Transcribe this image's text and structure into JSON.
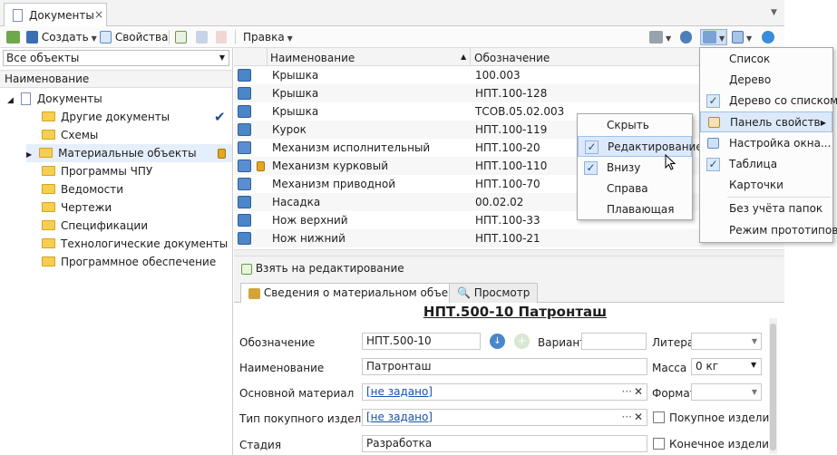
{
  "tab": {
    "title": "Документы",
    "close": "×"
  },
  "toolbar": {
    "create": "Создать",
    "properties": "Свойства",
    "edit_menu": "Правка"
  },
  "left": {
    "filter": "Все объекты",
    "header": "Наименование",
    "root": "Документы",
    "items": [
      "Другие документы",
      "Схемы",
      "Материальные объекты",
      "Программы ЧПУ",
      "Ведомости",
      "Чертежи",
      "Спецификации",
      "Технологические документы",
      "Программное обеспечение"
    ]
  },
  "grid": {
    "col_name": "Наименование",
    "col_designation": "Обозначение",
    "rows": [
      {
        "name": "Крышка",
        "designation": "100.003"
      },
      {
        "name": "Крышка",
        "designation": "НПТ.100-128"
      },
      {
        "name": "Крышка",
        "designation": "ТСОВ.05.02.003"
      },
      {
        "name": "Курок",
        "designation": "НПТ.100-119"
      },
      {
        "name": "Механизм исполнительный",
        "designation": "НПТ.100-20"
      },
      {
        "name": "Механизм курковый",
        "designation": "НПТ.100-110"
      },
      {
        "name": "Механизм приводной",
        "designation": "НПТ.100-70"
      },
      {
        "name": "Насадка",
        "designation": "00.02.02"
      },
      {
        "name": "Нож верхний",
        "designation": "НПТ.100-33"
      },
      {
        "name": "Нож нижний",
        "designation": "НПТ.100-21"
      }
    ]
  },
  "bottom": {
    "take_edit": "Взять на редактирование",
    "tab_info": "Сведения о материальном объекте",
    "tab_view": "Просмотр",
    "title": "НПТ.500-10 Патронташ",
    "labels": {
      "designation": "Обозначение",
      "variant": "Вариант",
      "litera": "Литера",
      "name": "Наименование",
      "mass": "Масса",
      "material": "Основной материал",
      "format": "Формат",
      "purchase_type": "Тип покупного изделия",
      "purchased": "Покупное изделие",
      "stage": "Стадия",
      "final": "Конечное изделие"
    },
    "values": {
      "designation": "НПТ.500-10",
      "name": "Патронташ",
      "mass": "0 кг",
      "material": "[не задано]",
      "purchase_type": "[не задано]",
      "stage": "Разработка"
    }
  },
  "context_menu": {
    "items": [
      "Скрыть",
      "Редактирование",
      "Внизу",
      "Справа",
      "Плавающая"
    ],
    "checked": [
      "Редактирование",
      "Внизу"
    ]
  },
  "view_menu": {
    "items": [
      "Список",
      "Дерево",
      "Дерево со списком",
      "Панель свойств",
      "Настройка окна...",
      "Таблица",
      "Карточки",
      "Без учёта папок",
      "Режим прототипов"
    ],
    "checked": [
      "Дерево со списком",
      "Таблица"
    ]
  }
}
